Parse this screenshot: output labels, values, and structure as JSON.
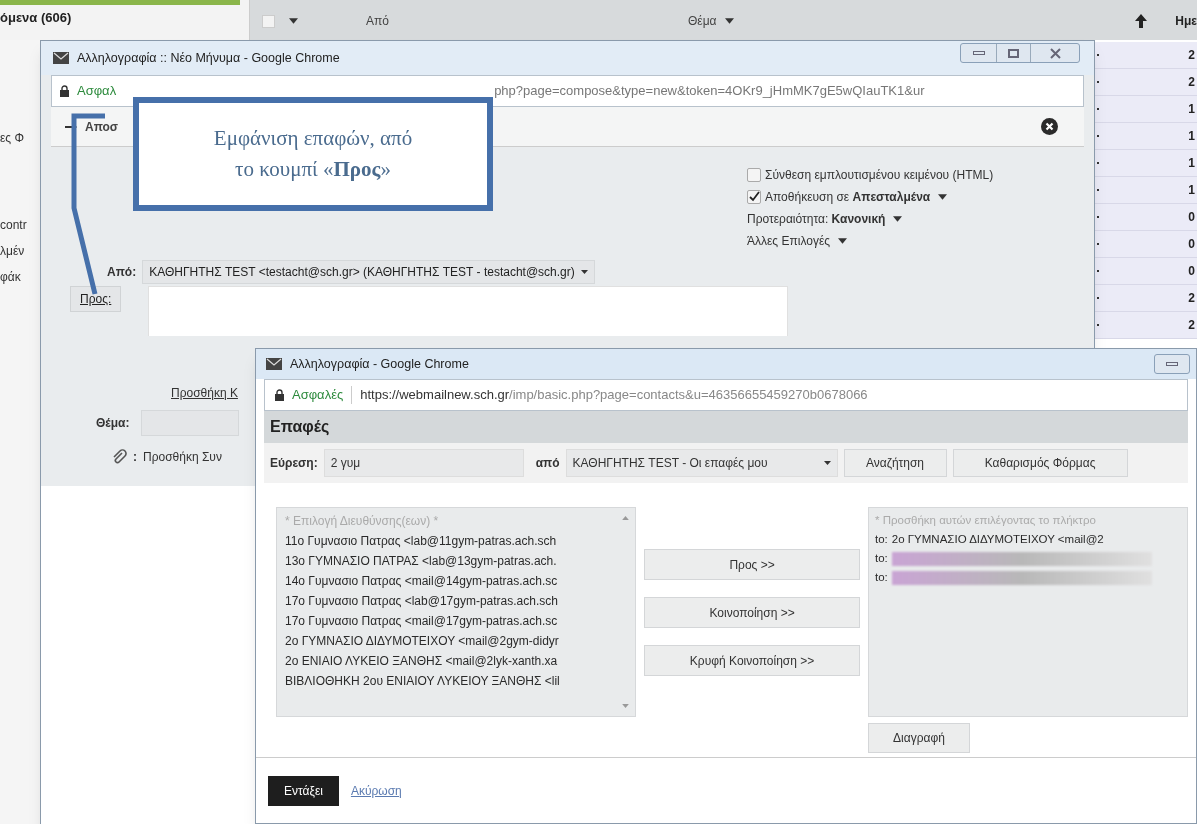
{
  "background_page": {
    "folder_title": "όμενα (606)",
    "select_all_checked": false,
    "columns": [
      {
        "label": "Από",
        "sort_menu": false
      },
      {
        "label": "Θέμα",
        "sort_menu": true
      },
      {
        "label": "Ημε",
        "sort_menu": false
      }
    ],
    "sidebar_fragments": [
      "ες Φ",
      "contr",
      "λμέν",
      "φάκ"
    ],
    "date_column": [
      "2",
      "2",
      "1",
      "1",
      "1",
      "1",
      "0",
      "0",
      "0",
      "2",
      "2"
    ]
  },
  "compose_window": {
    "title": "Αλληλογραφία :: Νέο Μήνυμα - Google Chrome",
    "security_label": "Ασφαλ",
    "url": "php?page=compose&type=new&token=4OKr9_jHmMK7gE5wQIauTK1&ur",
    "toolbar_label": "Αποσ",
    "options": [
      {
        "kind": "checkbox",
        "text": "Σύνθεση εμπλουτισμένου κειμένου (HTML)",
        "checked": false,
        "dropdown": false
      },
      {
        "kind": "checkbox",
        "text": "Αποθήκευση σε **Απεσταλμένα**",
        "checked": true,
        "dropdown": true
      },
      {
        "kind": "menu",
        "text": "Προτεραιότητα: **Κανονική**",
        "dropdown": true
      },
      {
        "kind": "menu",
        "text": "Άλλες Επιλογές",
        "dropdown": true
      }
    ],
    "from_label": "Από:",
    "from_value": "ΚΑΘΗΓΗΤΗΣ TEST <testacht@sch.gr> (ΚΑΘΗΓΗΤΗΣ TEST - testacht@sch.gr)",
    "to_button": "Προς:",
    "add_cc_link": "Προσθήκη Κ",
    "subject_label": "Θέμα:",
    "attach_separator": ":",
    "attach_link": "Προσθήκη Συν"
  },
  "contacts_window": {
    "title": "Αλληλογραφία - Google Chrome",
    "security_label": "Ασφαλές",
    "url_host": "https://webmailnew.sch.gr",
    "url_path": "/imp/basic.php?page=contacts&u=46356655459270b0678066",
    "heading": "Επαφές",
    "search_label": "Εύρεση:",
    "search_value": "2 γυμ",
    "source_label": "από",
    "source_value": "ΚΑΘΗΓΗΤΗΣ TEST - Οι επαφές μου",
    "search_button": "Αναζήτηση",
    "clear_button": "Καθαρισμός Φόρμας",
    "address_list": {
      "header": "* Επιλογή Διευθύνσης(εων) *",
      "items": [
        "11ο Γυμνασιο Πατρας <lab@11gym-patras.ach.sch",
        "13ο ΓΥΜΝΑΣΙΟ ΠΑΤΡΑΣ <lab@13gym-patras.ach.",
        "14ο Γυμνασιο Πατρας <mail@14gym-patras.ach.sc",
        "17ο Γυμνασιο Πατρας <lab@17gym-patras.ach.sch",
        "17ο Γυμνασιο Πατρας <mail@17gym-patras.ach.sc",
        "2ο ΓΥΜΝΑΣΙΟ ΔΙΔΥΜΟΤΕΙΧΟΥ <mail@2gym-didyr",
        "2ο ΕΝΙΑΙΟ ΛΥΚΕΙΟ ΞΑΝΘΗΣ <mail@2lyk-xanth.xa",
        "ΒΙΒΛΙΟΘΗΚΗ 2ου ΕΝΙΑΙΟΥ ΛΥΚΕΙΟΥ ΞΑΝΘΗΣ <lil"
      ]
    },
    "action_buttons": [
      "Προς >>",
      "Κοινοποίηση >>",
      "Κρυφή Κοινοποίηση >>"
    ],
    "recipients": {
      "header": "* Προσθήκη αυτών επιλέγοντας το πλήκτρο",
      "items": [
        {
          "prefix": "to:",
          "text": "2ο ΓΥΜΝΑΣΙΟ ΔΙΔΥΜΟΤΕΙΧΟΥ <mail@2",
          "blurred": false
        },
        {
          "prefix": "to:",
          "blurred": true
        },
        {
          "prefix": "to:",
          "blurred": true
        }
      ]
    },
    "delete_button": "Διαγραφή",
    "ok_button": "Εντάξει",
    "cancel_link": "Ακύρωση"
  },
  "callout": {
    "lines": [
      "Εμφάνιση επαφών, από",
      "το κουμπί «**Προς**»"
    ]
  }
}
